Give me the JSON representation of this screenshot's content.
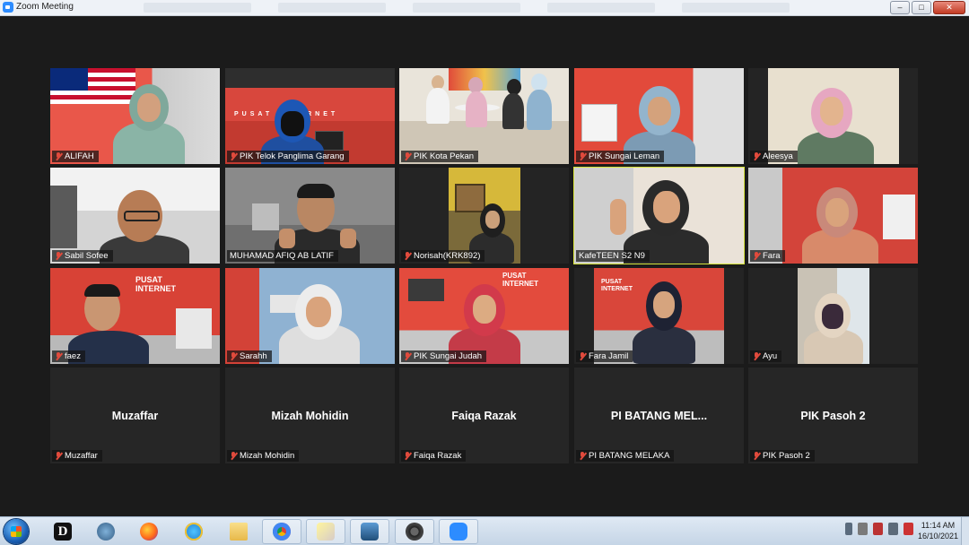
{
  "window": {
    "title": "Zoom Meeting",
    "controls": {
      "minimize": "–",
      "maximize": "□",
      "close": "✕"
    }
  },
  "participants": [
    {
      "name": "ALIFAH",
      "muted": true,
      "video": true,
      "scene": "flag"
    },
    {
      "name": "PIK Telok Panglima Garang",
      "muted": true,
      "video": true,
      "scene": "red-office"
    },
    {
      "name": "PIK Kota Pekan",
      "muted": true,
      "video": true,
      "scene": "group"
    },
    {
      "name": "PIK Sungai Leman",
      "muted": true,
      "video": true,
      "scene": "red-wall"
    },
    {
      "name": "Aleesya",
      "muted": true,
      "video": true,
      "scene": "beige"
    },
    {
      "name": "Sabil Sofee",
      "muted": true,
      "video": true,
      "scene": "white-room"
    },
    {
      "name": "MUHAMAD AFIQ AB LATIF",
      "muted": false,
      "video": true,
      "scene": "grey-room"
    },
    {
      "name": "Norisah(KRK892)",
      "muted": true,
      "video": true,
      "scene": "small-yellow"
    },
    {
      "name": "KafeTEEN S2 N9",
      "muted": false,
      "video": true,
      "scene": "active-speaker",
      "active": true
    },
    {
      "name": "Fara",
      "muted": true,
      "video": true,
      "scene": "red-office-2"
    },
    {
      "name": "faez",
      "muted": true,
      "video": true,
      "scene": "pusat-internet"
    },
    {
      "name": "Sarahh",
      "muted": true,
      "video": true,
      "scene": "blue-room"
    },
    {
      "name": "PIK Sungai Judah",
      "muted": true,
      "video": true,
      "scene": "red-office-3"
    },
    {
      "name": "Fara Jamil",
      "muted": true,
      "video": true,
      "scene": "pusat-internet-2"
    },
    {
      "name": "Ayu",
      "muted": true,
      "video": true,
      "scene": "small-window"
    },
    {
      "name": "Muzaffar",
      "display": "Muzaffar",
      "muted": true,
      "video": false
    },
    {
      "name": "Mizah Mohidin",
      "display": "Mizah Mohidin",
      "muted": true,
      "video": false
    },
    {
      "name": "Faiqa Razak",
      "display": "Faiqa Razak",
      "muted": true,
      "video": false
    },
    {
      "name": "PI BATANG MELAKA",
      "display": "PI BATANG MEL...",
      "muted": true,
      "video": false
    },
    {
      "name": "PIK Pasoh 2",
      "display": "PIK Pasoh 2",
      "muted": true,
      "video": false
    }
  ],
  "tile_texts": {
    "telok_sign": "PUSAT INTERNET",
    "faez_sign": "PUSAT INTERNET",
    "judah_sign": "PUSAT INTERNET",
    "jamil_sign": "PUSAT INTERNET"
  },
  "taskbar": {
    "time": "11:14 AM",
    "date": "16/10/2021",
    "apps": [
      "start",
      "dictionary-app",
      "security-app",
      "firefox",
      "internet-explorer",
      "file-explorer",
      "chrome",
      "sticky-notes",
      "remote-desktop",
      "camera-app",
      "zoom"
    ]
  }
}
